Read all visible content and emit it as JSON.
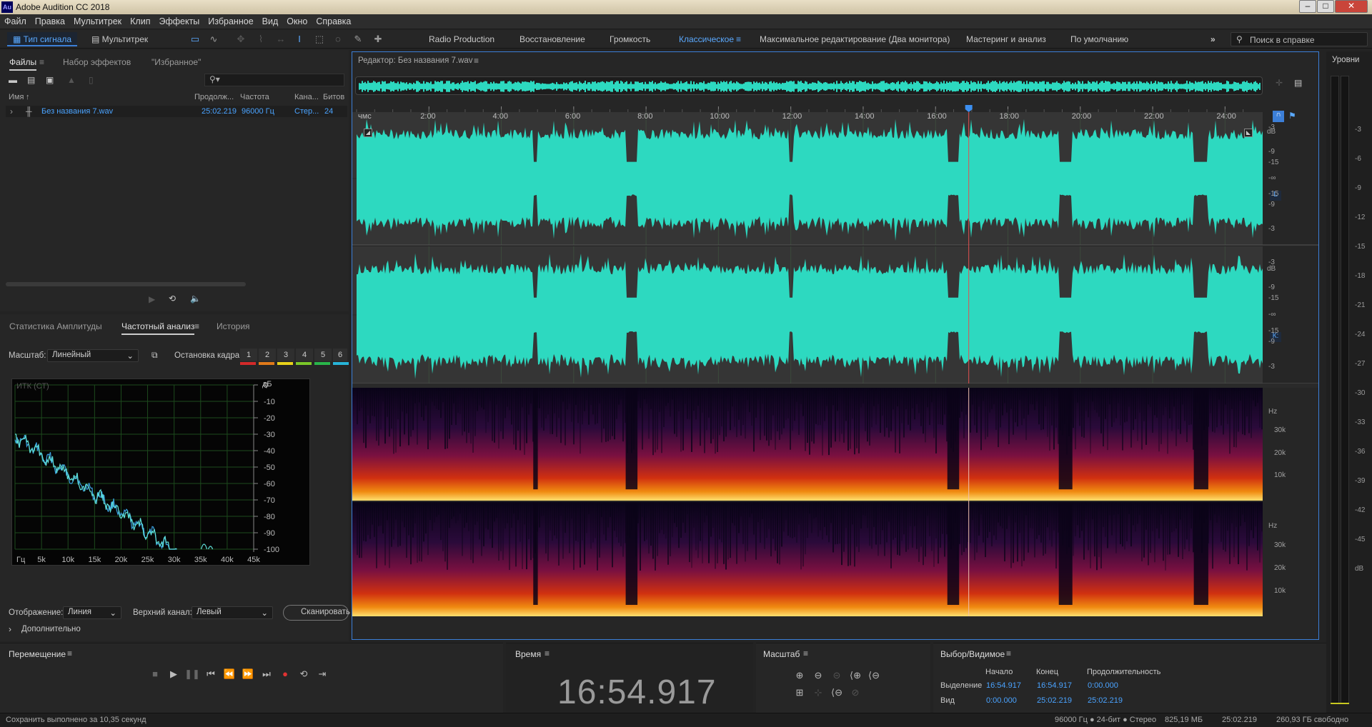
{
  "window": {
    "title": "Adobe Audition CC 2018",
    "logo_text": "Au"
  },
  "menu": [
    "Файл",
    "Правка",
    "Мультитрек",
    "Клип",
    "Эффекты",
    "Избранное",
    "Вид",
    "Окно",
    "Справка"
  ],
  "toolbar": {
    "waveform_label": "Тип сигнала",
    "multitrack_label": "Мультитрек",
    "workspaces": [
      "Radio Production",
      "Восстановление",
      "Громкость",
      "Классическое",
      "Максимальное редактирование (Два монитора)",
      "Мастеринг и анализ",
      "По умолчанию"
    ],
    "active_workspace": "Классическое",
    "help_placeholder": "Поиск в справке"
  },
  "files_panel": {
    "tabs": [
      "Файлы",
      "Набор эффектов",
      "\"Избранное\""
    ],
    "columns": [
      "Имя",
      "Продолж...",
      "Частота",
      "Кана...",
      "Битов"
    ],
    "file": {
      "name": "Без названия 7.wav",
      "duration": "25:02.219",
      "rate": "96000 Гц",
      "channels": "Стер...",
      "bits": "24"
    }
  },
  "analysis_panel": {
    "tabs": [
      "Статистика Амплитуды",
      "Частотный анализ",
      "История"
    ],
    "scale_label": "Масштаб:",
    "scale_value": "Линейный",
    "frame_stop_label": "Остановка кадра:",
    "frames": [
      "1",
      "2",
      "3",
      "4",
      "5",
      "6"
    ],
    "frame_colors": [
      "#d42a2a",
      "#e07a1a",
      "#e8d21a",
      "#7bc829",
      "#29b54a",
      "#27b4d8"
    ],
    "plot_label": "ИТК (СТ)",
    "y_unit": "дБ",
    "y_ticks": [
      "0",
      "-10",
      "-20",
      "-30",
      "-40",
      "-50",
      "-60",
      "-70",
      "-80",
      "-90",
      "-100"
    ],
    "x_ticks": [
      "Гц",
      "5k",
      "10k",
      "15k",
      "20k",
      "25k",
      "30k",
      "35k",
      "40k",
      "45k"
    ],
    "display_label": "Отображение:",
    "display_value": "Линия",
    "channel_label": "Верхний канал:",
    "channel_value": "Левый",
    "scan_button": "Сканировать",
    "more_label": "Дополнительно"
  },
  "editor": {
    "title": "Редактор: Без названия 7.wav",
    "ruler_unit": "чмс",
    "ruler": [
      "2:00",
      "4:00",
      "6:00",
      "8:00",
      "10:00",
      "12:00",
      "14:00",
      "16:00",
      "18:00",
      "20:00",
      "22:00",
      "24:00"
    ],
    "db_unit": "dB",
    "db_labels_top": [
      "-3",
      "-9",
      "-15",
      "-∞",
      "-15",
      "-9",
      "-3"
    ],
    "db_labels_bottom": [
      "-3",
      "-9",
      "-15",
      "-∞",
      "-15",
      "-9",
      "-3"
    ],
    "channel_left": "L",
    "channel_right": "К:",
    "hz_unit": "Hz",
    "hz_labels": [
      "30k",
      "20k",
      "10k"
    ],
    "wave_color": "#2dd9c0"
  },
  "levels": {
    "title": "Уровни",
    "ticks": [
      "-3",
      "-6",
      "-9",
      "-12",
      "-15",
      "-18",
      "-21",
      "-24",
      "-27",
      "-30",
      "-33",
      "-36",
      "-39",
      "-42",
      "-45",
      "dB"
    ]
  },
  "transport": {
    "title": "Перемещение"
  },
  "time": {
    "title": "Время",
    "value": "16:54.917"
  },
  "zoom": {
    "title": "Масштаб"
  },
  "selection": {
    "title": "Выбор/Видимое",
    "headers": [
      "Начало",
      "Конец",
      "Продолжительность"
    ],
    "rows": [
      {
        "label": "Выделение",
        "start": "16:54.917",
        "end": "16:54.917",
        "duration": "0:00.000"
      },
      {
        "label": "Вид",
        "start": "0:00.000",
        "end": "25:02.219",
        "duration": "25:02.219"
      }
    ]
  },
  "status": {
    "message": "Сохранить выполнено за 10,35 секунд",
    "format": "96000 Гц ● 24-бит ● Стерео",
    "size": "825,19 МБ",
    "duration": "25:02.219",
    "free": "260,93 ГБ свободно"
  }
}
